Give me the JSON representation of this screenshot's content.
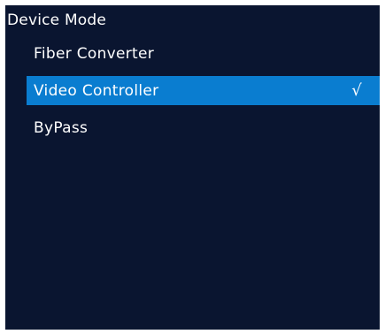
{
  "page": {
    "title": "Device Mode"
  },
  "menu": {
    "items": [
      {
        "label": "Fiber Converter",
        "selected": false
      },
      {
        "label": "Video Controller",
        "selected": true,
        "check": "√"
      },
      {
        "label": "ByPass",
        "selected": false
      }
    ]
  },
  "colors": {
    "background": "#0a1530",
    "highlight": "#0a7dd0",
    "text": "#ffffff"
  },
  "icons": {
    "selected_indicator": "check-icon"
  }
}
